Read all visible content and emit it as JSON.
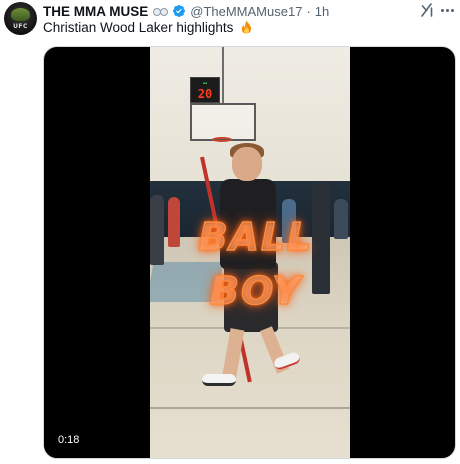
{
  "tweet": {
    "display_name": "THE MMA MUSE",
    "handle": "@TheMMAMuse17",
    "separator": "·",
    "time": "1h",
    "text": "Christian Wood Laker highlights",
    "avatar_tag": "UFC"
  },
  "icons": {
    "avatar_emoji": "goggles-icon",
    "verified": "verified-badge-icon",
    "grok": "grok-icon",
    "more": "more-icon",
    "text_emoji": "fire-icon"
  },
  "colors": {
    "verified_blue": "#1d9bf0",
    "secondary_text": "#536471",
    "primary_text": "#0f1419",
    "overlay_glow": "#ff8a3a"
  },
  "video": {
    "duration": "0:18",
    "overlay_line1": "BALL",
    "overlay_line2": "BOY",
    "scoreboard_value": "20"
  }
}
